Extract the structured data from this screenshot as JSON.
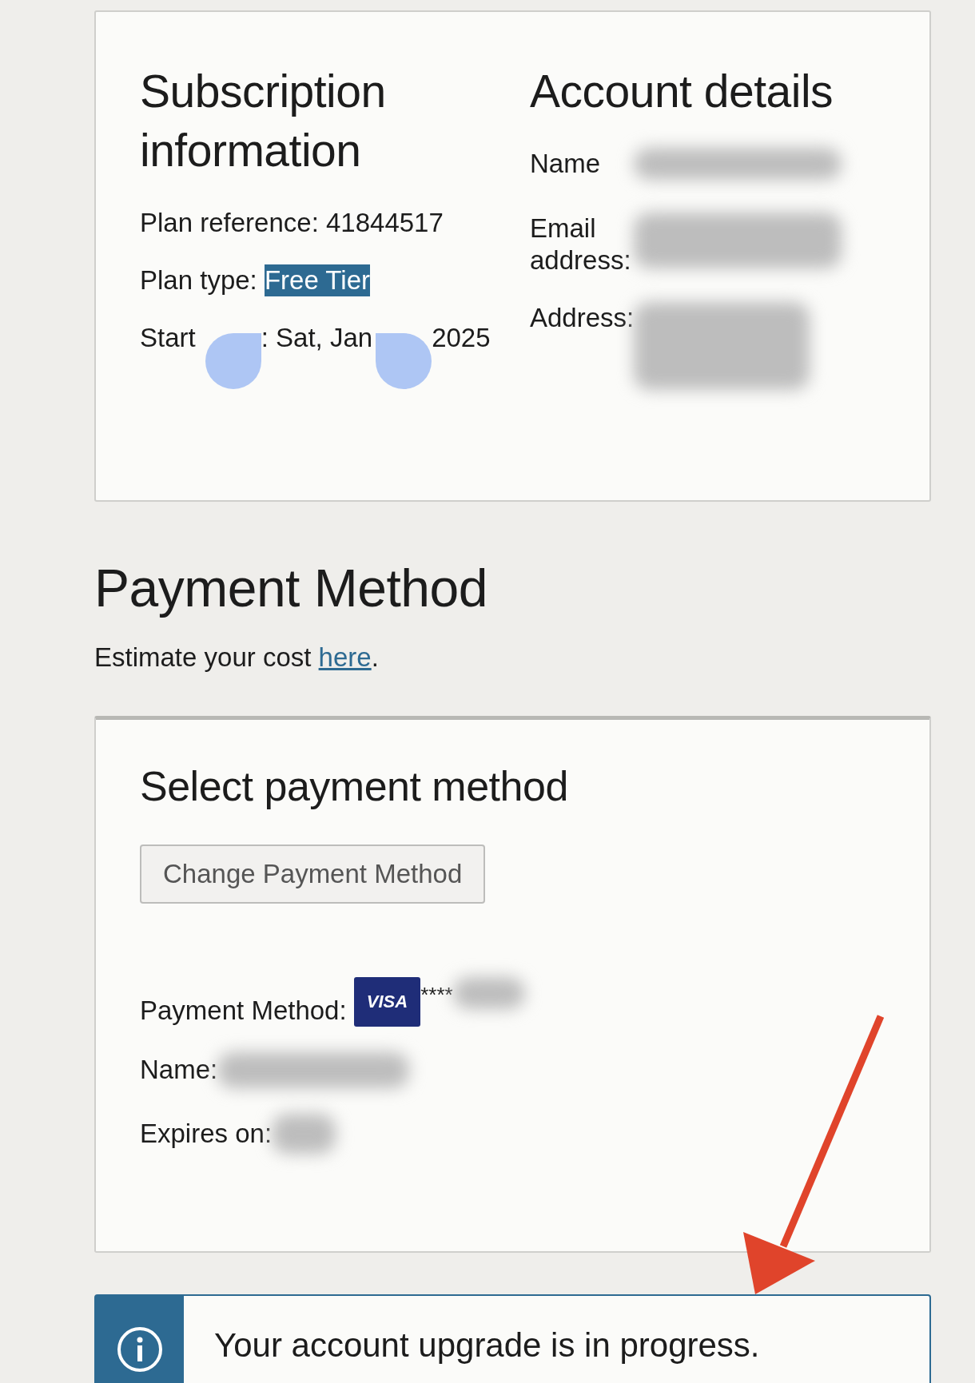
{
  "subscription": {
    "title": "Subscription information",
    "plan_reference": "Plan reference: 41844517",
    "plan_type": {
      "label": "Plan type:",
      "value": "Free Tier",
      "selected": true
    },
    "start_date": [
      "Start",
      ": Sat, Jan",
      "2025"
    ]
  },
  "account": {
    "title": "Account details",
    "fields": [
      {
        "label": "Name"
      },
      {
        "label": "Email address:"
      },
      {
        "label": "Address:"
      }
    ]
  },
  "payment": {
    "title": "Payment Method",
    "estimate": {
      "text": "Estimate your cost",
      "link": "here",
      "end": "."
    },
    "card": {
      "title": "Select payment method",
      "button": "Change Payment Method",
      "method_label": "Payment Method:",
      "card_brand": "VISA",
      "masked": "****",
      "name_label": "Name:",
      "expires_label": "Expires on:"
    }
  },
  "banner": {
    "message": "Your account upgrade is in progress."
  }
}
